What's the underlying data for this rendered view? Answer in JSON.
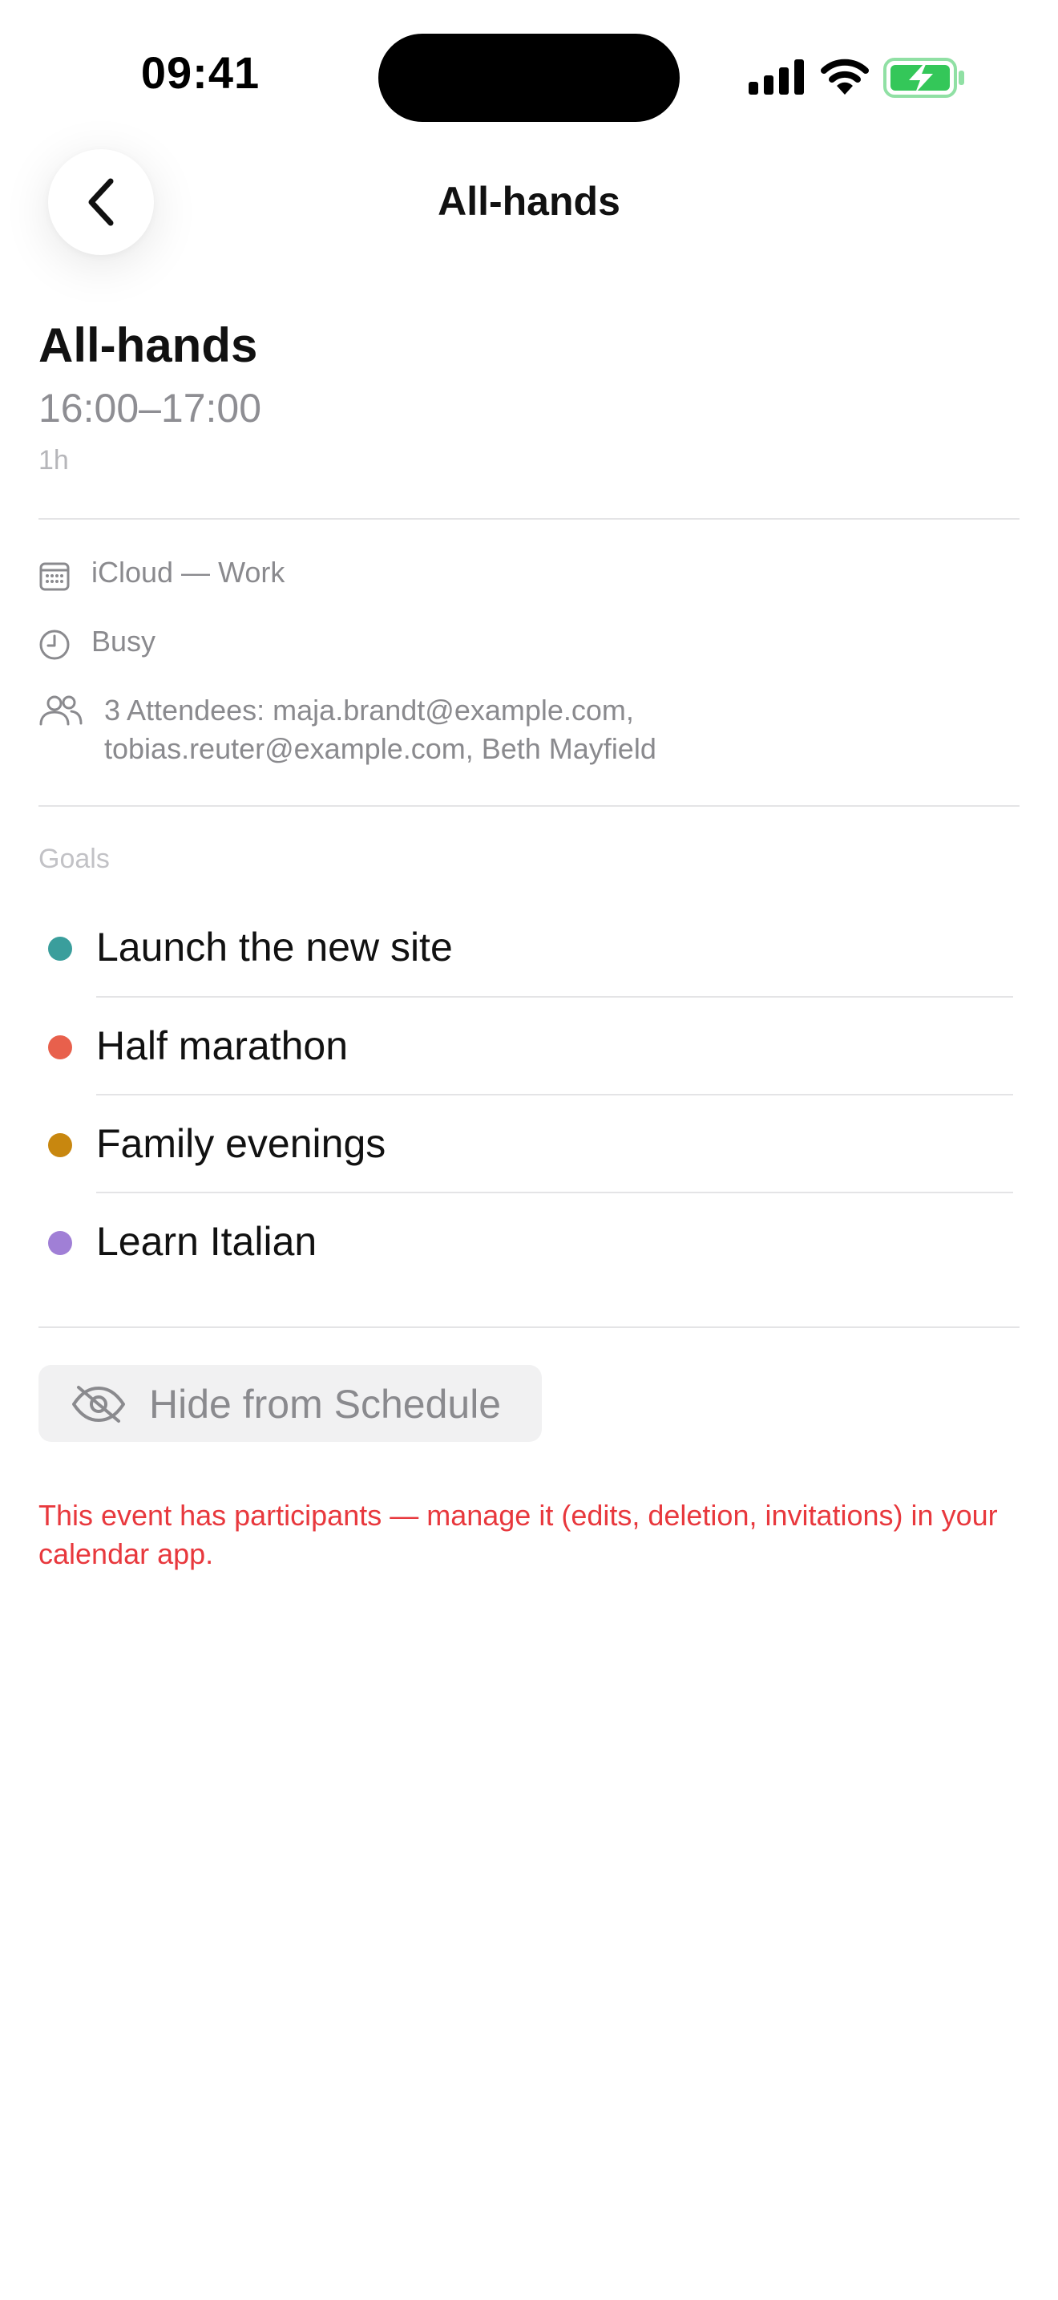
{
  "status_bar": {
    "time": "09:41"
  },
  "nav": {
    "title": "All-hands",
    "back_icon": "chevron-left-icon"
  },
  "event": {
    "title": "All-hands",
    "time_range": "16:00–17:00",
    "duration": "1h"
  },
  "details": {
    "calendar": "iCloud — Work",
    "availability": "Busy",
    "attendees_line1": "3 Attendees: maja.brandt@example.com,",
    "attendees_line2": "tobias.reuter@example.com, Beth Mayfield"
  },
  "goals": {
    "section_label": "Goals",
    "items": [
      {
        "label": "Launch the new site",
        "color": "#3a9e9c"
      },
      {
        "label": "Half marathon",
        "color": "#e8604c"
      },
      {
        "label": "Family evenings",
        "color": "#c8870f"
      },
      {
        "label": "Learn Italian",
        "color": "#a07fd6"
      }
    ]
  },
  "actions": {
    "hide_label": "Hide from Schedule",
    "hide_icon": "eye-slash-icon"
  },
  "warning": "This event has participants — manage it (edits, deletion, invitations) in your calendar app.",
  "colors": {
    "warning": "#e8383d",
    "battery": "#34c759",
    "secondary_text": "#8a8a8e"
  }
}
